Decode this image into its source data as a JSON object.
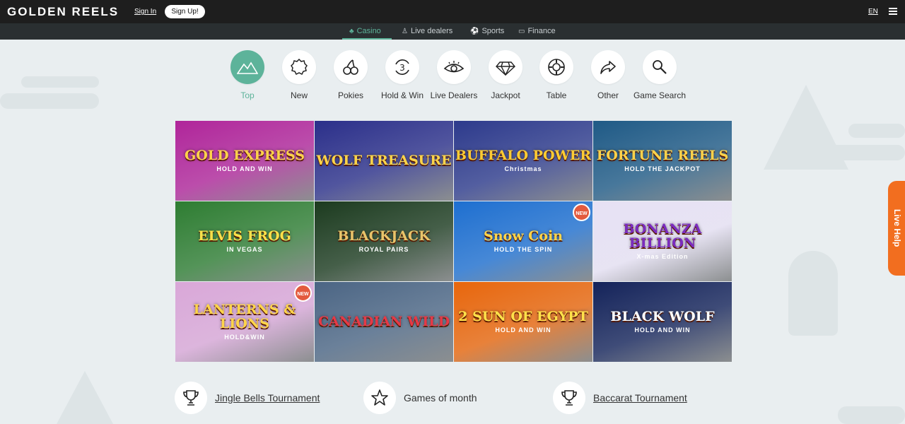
{
  "header": {
    "logo": "GOLDEN REELS",
    "sign_in": "Sign In",
    "sign_up": "Sign Up!",
    "language": "EN",
    "menu_icon": "hamburger-icon"
  },
  "subnav": [
    {
      "label": "Casino",
      "icon": "casino-icon",
      "active": true
    },
    {
      "label": "Live dealers",
      "icon": "person-icon",
      "active": false
    },
    {
      "label": "Sports",
      "icon": "ball-icon",
      "active": false
    },
    {
      "label": "Finance",
      "icon": "card-icon",
      "active": false
    }
  ],
  "categories": [
    {
      "label": "Top",
      "icon": "mountains-icon",
      "active": true
    },
    {
      "label": "New",
      "icon": "badge-icon",
      "active": false
    },
    {
      "label": "Pokies",
      "icon": "cherries-icon",
      "active": false
    },
    {
      "label": "Hold & Win",
      "icon": "refresh-3-icon",
      "active": false
    },
    {
      "label": "Live Dealers",
      "icon": "eye-icon",
      "active": false
    },
    {
      "label": "Jackpot",
      "icon": "diamond-icon",
      "active": false
    },
    {
      "label": "Table",
      "icon": "chip-icon",
      "active": false
    },
    {
      "label": "Other",
      "icon": "share-arrow-icon",
      "active": false
    },
    {
      "label": "Game Search",
      "icon": "search-icon",
      "active": false
    }
  ],
  "games": [
    {
      "title": "GOLD EXPRESS",
      "subtitle": "HOLD AND WIN",
      "new": false,
      "bg": "#b0259a",
      "fg": "#ffd24a"
    },
    {
      "title": "WOLF TREASURE",
      "subtitle": "",
      "new": false,
      "bg": "#2b2f8a",
      "fg": "#ffd54a"
    },
    {
      "title": "BUFFALO POWER",
      "subtitle": "Christmas",
      "new": false,
      "bg": "#2d3a8c",
      "fg": "#ffcc33"
    },
    {
      "title": "FORTUNE REELS",
      "subtitle": "HOLD THE JACKPOT",
      "new": false,
      "bg": "#1f5a86",
      "fg": "#ffd24a"
    },
    {
      "title": "ELVIS FROG",
      "subtitle": "IN VEGAS",
      "new": false,
      "bg": "#2e7d32",
      "fg": "#ffe14a"
    },
    {
      "title": "BLACKJACK",
      "subtitle": "ROYAL PAIRS",
      "new": false,
      "bg": "#1c3b1f",
      "fg": "#e9c46a"
    },
    {
      "title": "Snow Coin",
      "subtitle": "HOLD THE SPIN",
      "new": true,
      "bg": "#1e6fd0",
      "fg": "#ffd54a"
    },
    {
      "title": "BONANZA BILLION",
      "subtitle": "X-mas Edition",
      "new": false,
      "bg": "#e7e1f4",
      "fg": "#7b2cbf"
    },
    {
      "title": "LANTERNS & LIONS",
      "subtitle": "HOLD&WIN",
      "new": true,
      "bg": "#d9a7d8",
      "fg": "#ffd54a"
    },
    {
      "title": "CANADIAN WILD",
      "subtitle": "",
      "new": false,
      "bg": "#4b6584",
      "fg": "#e63946"
    },
    {
      "title": "2 SUN OF EGYPT",
      "subtitle": "HOLD AND WIN",
      "new": false,
      "bg": "#e8660c",
      "fg": "#ffe14a"
    },
    {
      "title": "BLACK WOLF",
      "subtitle": "HOLD AND WIN",
      "new": false,
      "bg": "#14235a",
      "fg": "#ffffff"
    }
  ],
  "new_badge": "NEW",
  "tournaments": [
    {
      "label": "Jingle Bells Tournament",
      "icon": "trophy-icon",
      "link": true
    },
    {
      "label": "Games of month",
      "icon": "star-icon",
      "link": false
    },
    {
      "label": "Baccarat Tournament",
      "icon": "trophy-icon",
      "link": true
    }
  ],
  "live_help": "Live Help",
  "colors": {
    "accent": "#5db39a",
    "topbar": "#1e1e1e",
    "live_help": "#f26e1f"
  }
}
